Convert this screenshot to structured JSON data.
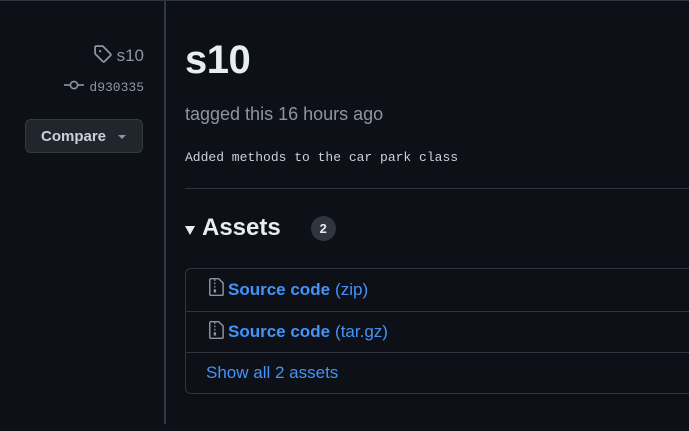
{
  "sidebar": {
    "tag_name": "s10",
    "commit_sha": "d930335",
    "compare_label": "Compare"
  },
  "release": {
    "title": "s10",
    "tagged_text": "tagged this 16 hours ago",
    "notes": "Added methods to the car park class"
  },
  "assets": {
    "heading": "Assets",
    "count": "2",
    "items": [
      {
        "name": "Source code",
        "ext": "(zip)"
      },
      {
        "name": "Source code",
        "ext": "(tar.gz)"
      }
    ],
    "show_all_label": "Show all 2 assets"
  },
  "icons": {
    "tag": "tag-icon",
    "commit": "git-commit-icon",
    "archive": "file-zip-icon",
    "caret": "caret-down-icon",
    "triangle": "triangle-down-icon"
  },
  "colors": {
    "background": "#0d1117",
    "link": "#4493f8",
    "muted": "#8d96a0",
    "border": "#30363d",
    "button_bg": "#21262d"
  }
}
